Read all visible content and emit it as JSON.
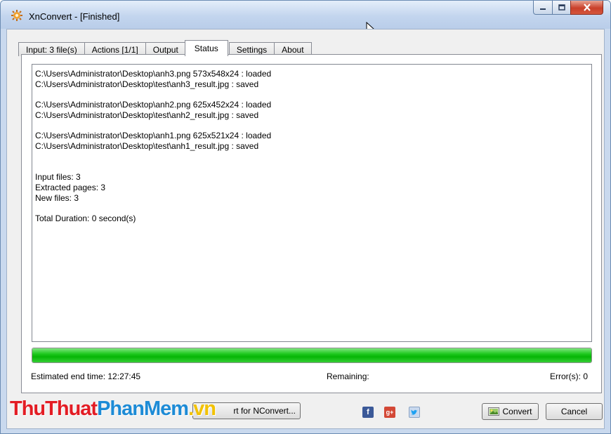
{
  "window": {
    "title": "XnConvert - [Finished]"
  },
  "tabs": [
    {
      "label": "Input: 3 file(s)",
      "active": false
    },
    {
      "label": "Actions [1/1]",
      "active": false
    },
    {
      "label": "Output",
      "active": false
    },
    {
      "label": "Status",
      "active": true
    },
    {
      "label": "Settings",
      "active": false
    },
    {
      "label": "About",
      "active": false
    }
  ],
  "log": {
    "lines": [
      "C:\\Users\\Administrator\\Desktop\\anh3.png 573x548x24 : loaded",
      "C:\\Users\\Administrator\\Desktop\\test\\anh3_result.jpg : saved",
      "C:\\Users\\Administrator\\Desktop\\anh2.png 625x452x24 : loaded",
      "C:\\Users\\Administrator\\Desktop\\test\\anh2_result.jpg : saved",
      "C:\\Users\\Administrator\\Desktop\\anh1.png 625x521x24 : loaded",
      "C:\\Users\\Administrator\\Desktop\\test\\anh1_result.jpg : saved",
      "Input files: 3",
      "Extracted pages: 3",
      "New files: 3",
      "Total Duration: 0 second(s)"
    ]
  },
  "progress": {
    "value": 1.0,
    "color": "#06b606"
  },
  "status": {
    "estimated_end_time": "Estimated end time:  12:27:45",
    "remaining": "Remaining:",
    "errors": "Error(s):  0"
  },
  "watermark": {
    "part1": "ThuThuat",
    "part2": "PhanMem",
    "part3": ".vn"
  },
  "buttons": {
    "export_label": "rt for NConvert...",
    "convert_label": "Convert",
    "cancel_label": "Cancel"
  },
  "social": {
    "facebook": "facebook-icon",
    "googleplus": "google-plus-icon",
    "twitter": "twitter-icon"
  },
  "colors": {
    "accent": "#1d8bd6",
    "brand_red": "#e31c24",
    "progress": "#06b606"
  }
}
